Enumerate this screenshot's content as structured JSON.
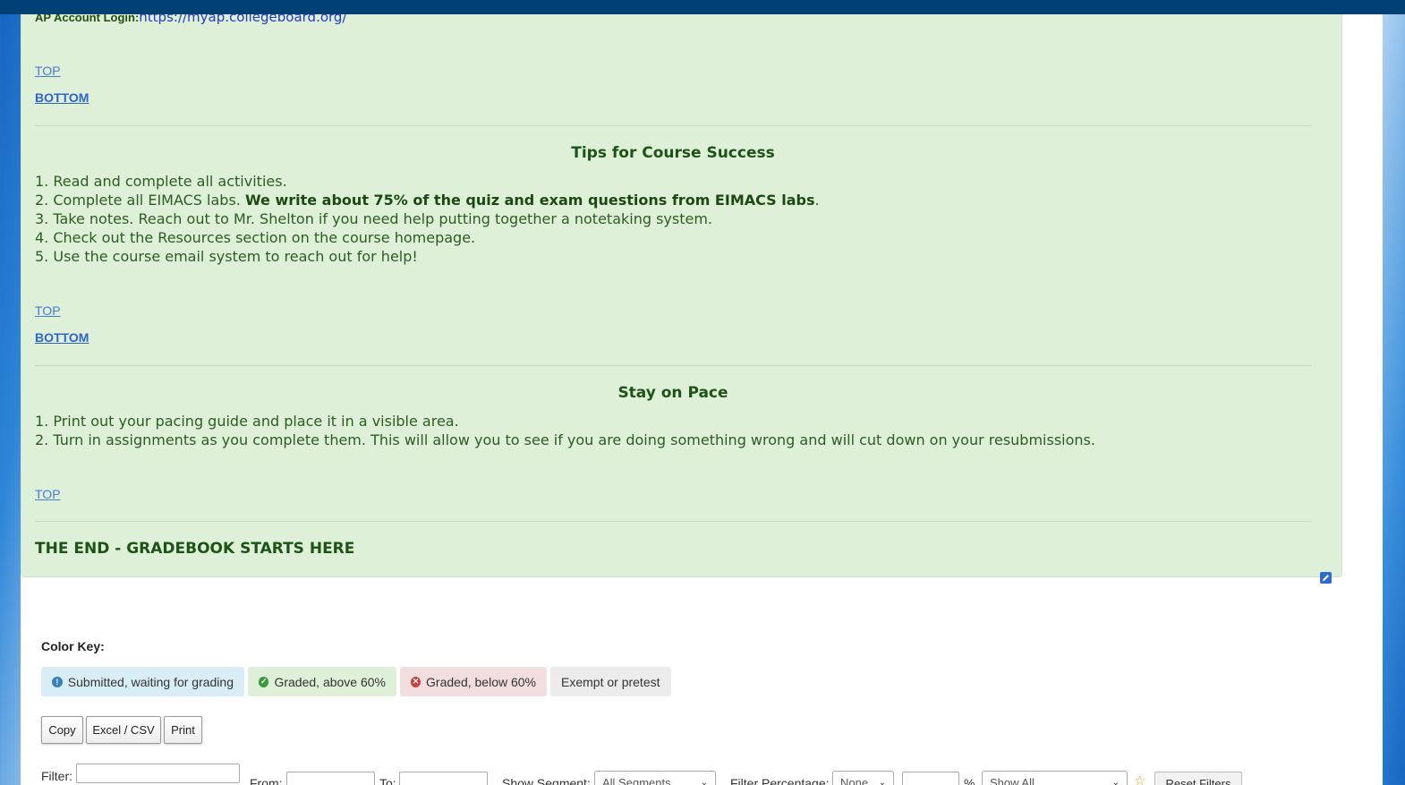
{
  "ap": {
    "label": "AP Account Login:",
    "url": "https://myap.collegeboard.org/"
  },
  "nav": {
    "top": "TOP",
    "bottom": "BOTTOM"
  },
  "tips": {
    "title": "Tips for Course Success",
    "items": [
      "1. Read and complete all activities.",
      "2. Complete all EIMACS labs. ",
      "3. Take notes. Reach out to Mr. Shelton if you need help putting together a notetaking system.",
      "4. Check out the Resources section on the course homepage.",
      "5. Use the course email system to reach out for help!"
    ],
    "item2_bold": "We write about 75% of the quiz and exam questions from EIMACS labs",
    "item2_end": "."
  },
  "pace": {
    "title": "Stay on Pace",
    "items": [
      "1. Print out your pacing guide and place it in a visible area.",
      "2. Turn in assignments as you complete them. This will allow you to see if you are doing something wrong and will cut down on your resubmissions."
    ]
  },
  "end_title": "THE END - GRADEBOOK STARTS HERE",
  "color_key": {
    "label": "Color Key:",
    "items": [
      {
        "text": "Submitted, waiting for grading",
        "icon": "info-icon",
        "bg": "#d9edf7"
      },
      {
        "text": "Graded, above 60%",
        "icon": "check-circle-icon",
        "bg": "#dff0d8"
      },
      {
        "text": "Graded, below 60%",
        "icon": "x-circle-icon",
        "bg": "#f2dede"
      },
      {
        "text": "Exempt or pretest",
        "icon": "",
        "bg": "#ececec"
      }
    ]
  },
  "export_buttons": [
    "Copy",
    "Excel / CSV",
    "Print"
  ],
  "filters": {
    "filter_label": "Filter:",
    "from_label": "From:",
    "to_label": "To:",
    "segment_label": "Show Segment:",
    "segment_value": "All Segments",
    "pct_label": "Filter Percentage:",
    "pct_value": "None",
    "pct_sign": "%",
    "show_value": "Show All",
    "reset": "Reset Filters"
  },
  "colors": {
    "topbar": "#003f73",
    "panel_bg": "#dff0d8",
    "heading_green": "#1d5317",
    "link_blue": "#2e63c9"
  }
}
